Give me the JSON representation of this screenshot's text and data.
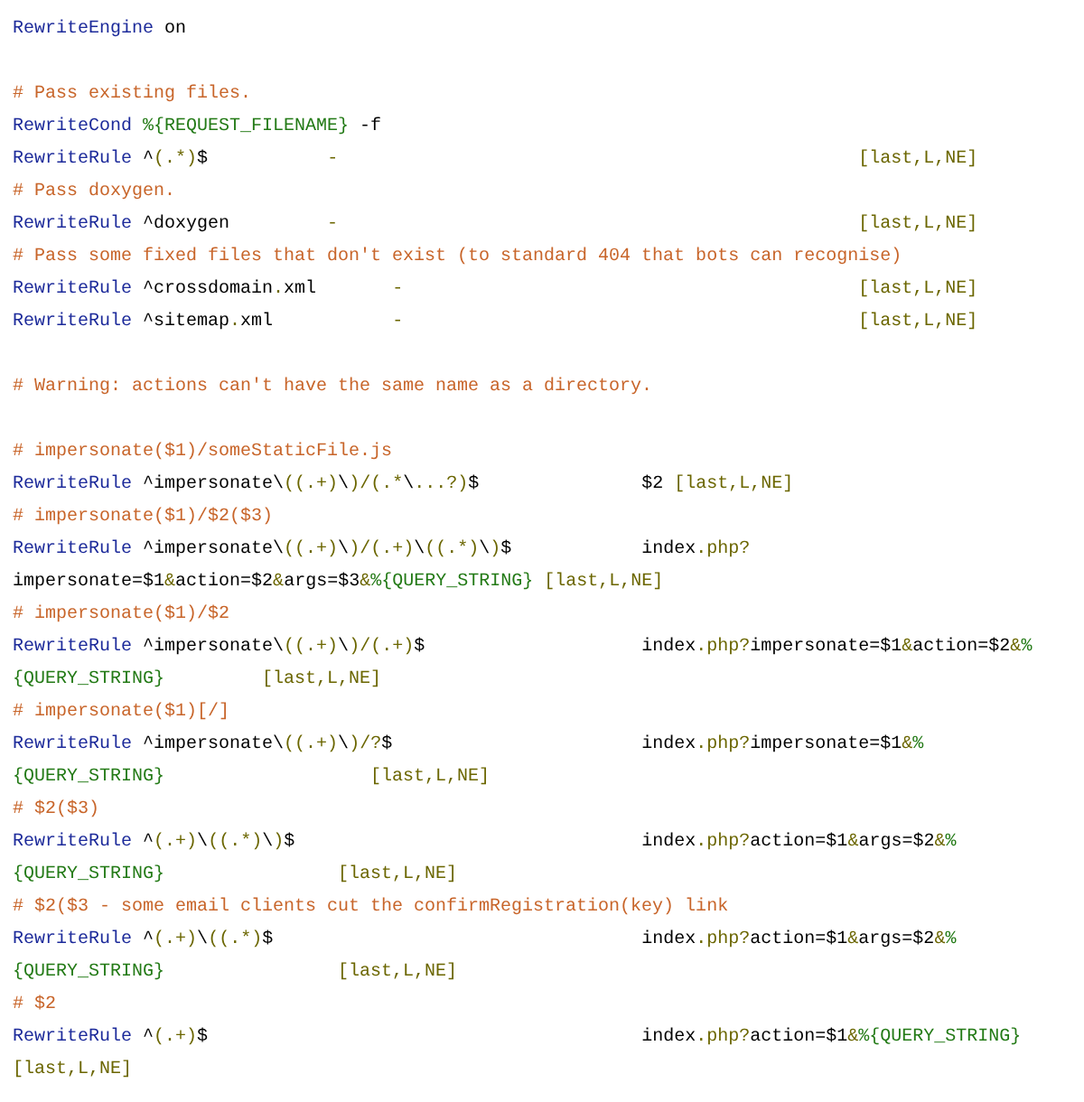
{
  "code_lines": [
    {
      "kind": "code",
      "tokens": [
        {
          "kind": "keyword",
          "text": "RewriteEngine"
        },
        {
          "kind": "plain",
          "text": " on"
        }
      ]
    },
    {
      "kind": "blank"
    },
    {
      "kind": "code",
      "tokens": [
        {
          "kind": "comment",
          "text": "# Pass existing files."
        }
      ]
    },
    {
      "kind": "code",
      "tokens": [
        {
          "kind": "keyword",
          "text": "RewriteCond"
        },
        {
          "kind": "variable",
          "text": " %{REQUEST_FILENAME}"
        },
        {
          "kind": "plain",
          "text": " -f"
        }
      ]
    },
    {
      "kind": "code",
      "tokens": [
        {
          "kind": "keyword",
          "text": "RewriteRule"
        },
        {
          "kind": "plain",
          "text": " ^"
        },
        {
          "kind": "punct",
          "text": "(.*)"
        },
        {
          "kind": "plain",
          "text": "$           "
        },
        {
          "kind": "punct",
          "text": "-                                                [last,L,NE]"
        }
      ]
    },
    {
      "kind": "code",
      "tokens": [
        {
          "kind": "comment",
          "text": "# Pass doxygen."
        }
      ]
    },
    {
      "kind": "code",
      "tokens": [
        {
          "kind": "keyword",
          "text": "RewriteRule"
        },
        {
          "kind": "plain",
          "text": " ^doxygen         "
        },
        {
          "kind": "punct",
          "text": "-                                                [last,L,NE]"
        }
      ]
    },
    {
      "kind": "code",
      "tokens": [
        {
          "kind": "comment",
          "text": "# Pass some fixed files that don't exist (to standard 404 that bots can recognise)"
        }
      ]
    },
    {
      "kind": "code",
      "tokens": [
        {
          "kind": "keyword",
          "text": "RewriteRule"
        },
        {
          "kind": "plain",
          "text": " ^crossdomain"
        },
        {
          "kind": "punct",
          "text": "."
        },
        {
          "kind": "plain",
          "text": "xml       "
        },
        {
          "kind": "punct",
          "text": "-                                          [last,L,NE]"
        }
      ]
    },
    {
      "kind": "code",
      "tokens": [
        {
          "kind": "keyword",
          "text": "RewriteRule"
        },
        {
          "kind": "plain",
          "text": " ^sitemap"
        },
        {
          "kind": "punct",
          "text": "."
        },
        {
          "kind": "plain",
          "text": "xml           "
        },
        {
          "kind": "punct",
          "text": "-                                          [last,L,NE]"
        }
      ]
    },
    {
      "kind": "blank"
    },
    {
      "kind": "code",
      "tokens": [
        {
          "kind": "comment",
          "text": "# Warning: actions can't have the same name as a directory."
        }
      ]
    },
    {
      "kind": "blank"
    },
    {
      "kind": "code",
      "tokens": [
        {
          "kind": "comment",
          "text": "# impersonate($1)/someStaticFile.js"
        }
      ]
    },
    {
      "kind": "code",
      "tokens": [
        {
          "kind": "keyword",
          "text": "RewriteRule"
        },
        {
          "kind": "plain",
          "text": " ^impersonate\\"
        },
        {
          "kind": "punct",
          "text": "((.+)"
        },
        {
          "kind": "plain",
          "text": "\\"
        },
        {
          "kind": "punct",
          "text": ")/(.*"
        },
        {
          "kind": "plain",
          "text": "\\"
        },
        {
          "kind": "punct",
          "text": "...?)"
        },
        {
          "kind": "plain",
          "text": "$               $2 "
        },
        {
          "kind": "punct",
          "text": "[last,L,NE]"
        }
      ]
    },
    {
      "kind": "code",
      "tokens": [
        {
          "kind": "comment",
          "text": "# impersonate($1)/$2($3)"
        }
      ]
    },
    {
      "kind": "code",
      "tokens": [
        {
          "kind": "keyword",
          "text": "RewriteRule"
        },
        {
          "kind": "plain",
          "text": " ^impersonate\\"
        },
        {
          "kind": "punct",
          "text": "((.+)"
        },
        {
          "kind": "plain",
          "text": "\\"
        },
        {
          "kind": "punct",
          "text": ")/(.+)"
        },
        {
          "kind": "plain",
          "text": "\\"
        },
        {
          "kind": "punct",
          "text": "((.*)"
        },
        {
          "kind": "plain",
          "text": "\\"
        },
        {
          "kind": "punct",
          "text": ")"
        },
        {
          "kind": "plain",
          "text": "$            index"
        },
        {
          "kind": "punct",
          "text": ".php?"
        }
      ]
    },
    {
      "kind": "code",
      "tokens": [
        {
          "kind": "plain",
          "text": "impersonate=$1"
        },
        {
          "kind": "punct",
          "text": "&"
        },
        {
          "kind": "plain",
          "text": "action=$2"
        },
        {
          "kind": "punct",
          "text": "&"
        },
        {
          "kind": "plain",
          "text": "args=$3"
        },
        {
          "kind": "punct",
          "text": "&"
        },
        {
          "kind": "variable",
          "text": "%{QUERY_STRING} "
        },
        {
          "kind": "punct",
          "text": "[last,L,NE]"
        }
      ]
    },
    {
      "kind": "code",
      "tokens": [
        {
          "kind": "comment",
          "text": "# impersonate($1)/$2"
        }
      ]
    },
    {
      "kind": "code",
      "tokens": [
        {
          "kind": "keyword",
          "text": "RewriteRule"
        },
        {
          "kind": "plain",
          "text": " ^impersonate\\"
        },
        {
          "kind": "punct",
          "text": "((.+)"
        },
        {
          "kind": "plain",
          "text": "\\"
        },
        {
          "kind": "punct",
          "text": ")/(.+)"
        },
        {
          "kind": "plain",
          "text": "$                    index"
        },
        {
          "kind": "punct",
          "text": ".php?"
        },
        {
          "kind": "plain",
          "text": "impersonate=$1"
        },
        {
          "kind": "punct",
          "text": "&"
        },
        {
          "kind": "plain",
          "text": "action=$2"
        },
        {
          "kind": "punct",
          "text": "&"
        },
        {
          "kind": "variable",
          "text": "%"
        }
      ]
    },
    {
      "kind": "code",
      "tokens": [
        {
          "kind": "variable",
          "text": "{QUERY_STRING}         "
        },
        {
          "kind": "punct",
          "text": "[last,L,NE]"
        }
      ]
    },
    {
      "kind": "code",
      "tokens": [
        {
          "kind": "comment",
          "text": "# impersonate($1)[/]"
        }
      ]
    },
    {
      "kind": "code",
      "tokens": [
        {
          "kind": "keyword",
          "text": "RewriteRule"
        },
        {
          "kind": "plain",
          "text": " ^impersonate\\"
        },
        {
          "kind": "punct",
          "text": "((.+)"
        },
        {
          "kind": "plain",
          "text": "\\"
        },
        {
          "kind": "punct",
          "text": ")/?"
        },
        {
          "kind": "plain",
          "text": "$                       index"
        },
        {
          "kind": "punct",
          "text": ".php?"
        },
        {
          "kind": "plain",
          "text": "impersonate=$1"
        },
        {
          "kind": "punct",
          "text": "&"
        },
        {
          "kind": "variable",
          "text": "%"
        }
      ]
    },
    {
      "kind": "code",
      "tokens": [
        {
          "kind": "variable",
          "text": "{QUERY_STRING}                   "
        },
        {
          "kind": "punct",
          "text": "[last,L,NE]"
        }
      ]
    },
    {
      "kind": "code",
      "tokens": [
        {
          "kind": "comment",
          "text": "# $2($3)"
        }
      ]
    },
    {
      "kind": "code",
      "tokens": [
        {
          "kind": "keyword",
          "text": "RewriteRule"
        },
        {
          "kind": "plain",
          "text": " ^"
        },
        {
          "kind": "punct",
          "text": "(.+)"
        },
        {
          "kind": "plain",
          "text": "\\"
        },
        {
          "kind": "punct",
          "text": "((.*)"
        },
        {
          "kind": "plain",
          "text": "\\"
        },
        {
          "kind": "punct",
          "text": ")"
        },
        {
          "kind": "plain",
          "text": "$                                index"
        },
        {
          "kind": "punct",
          "text": ".php?"
        },
        {
          "kind": "plain",
          "text": "action=$1"
        },
        {
          "kind": "punct",
          "text": "&"
        },
        {
          "kind": "plain",
          "text": "args=$2"
        },
        {
          "kind": "punct",
          "text": "&"
        },
        {
          "kind": "variable",
          "text": "%"
        }
      ]
    },
    {
      "kind": "code",
      "tokens": [
        {
          "kind": "variable",
          "text": "{QUERY_STRING}                "
        },
        {
          "kind": "punct",
          "text": "[last,L,NE]"
        }
      ]
    },
    {
      "kind": "code",
      "tokens": [
        {
          "kind": "comment",
          "text": "# $2($3 - some email clients cut the confirmRegistration(key) link"
        }
      ]
    },
    {
      "kind": "code",
      "tokens": [
        {
          "kind": "keyword",
          "text": "RewriteRule"
        },
        {
          "kind": "plain",
          "text": " ^"
        },
        {
          "kind": "punct",
          "text": "(.+)"
        },
        {
          "kind": "plain",
          "text": "\\"
        },
        {
          "kind": "punct",
          "text": "((.*)"
        },
        {
          "kind": "plain",
          "text": "$                                  index"
        },
        {
          "kind": "punct",
          "text": ".php?"
        },
        {
          "kind": "plain",
          "text": "action=$1"
        },
        {
          "kind": "punct",
          "text": "&"
        },
        {
          "kind": "plain",
          "text": "args=$2"
        },
        {
          "kind": "punct",
          "text": "&"
        },
        {
          "kind": "variable",
          "text": "%"
        }
      ]
    },
    {
      "kind": "code",
      "tokens": [
        {
          "kind": "variable",
          "text": "{QUERY_STRING}                "
        },
        {
          "kind": "punct",
          "text": "[last,L,NE]"
        }
      ]
    },
    {
      "kind": "code",
      "tokens": [
        {
          "kind": "comment",
          "text": "# $2"
        }
      ]
    },
    {
      "kind": "code",
      "tokens": [
        {
          "kind": "keyword",
          "text": "RewriteRule"
        },
        {
          "kind": "plain",
          "text": " ^"
        },
        {
          "kind": "punct",
          "text": "(.+)"
        },
        {
          "kind": "plain",
          "text": "$                                        index"
        },
        {
          "kind": "punct",
          "text": ".php?"
        },
        {
          "kind": "plain",
          "text": "action=$1"
        },
        {
          "kind": "punct",
          "text": "&"
        },
        {
          "kind": "variable",
          "text": "%{QUERY_STRING}"
        }
      ]
    },
    {
      "kind": "code",
      "tokens": [
        {
          "kind": "punct",
          "text": "[last,L,NE]"
        }
      ]
    }
  ]
}
